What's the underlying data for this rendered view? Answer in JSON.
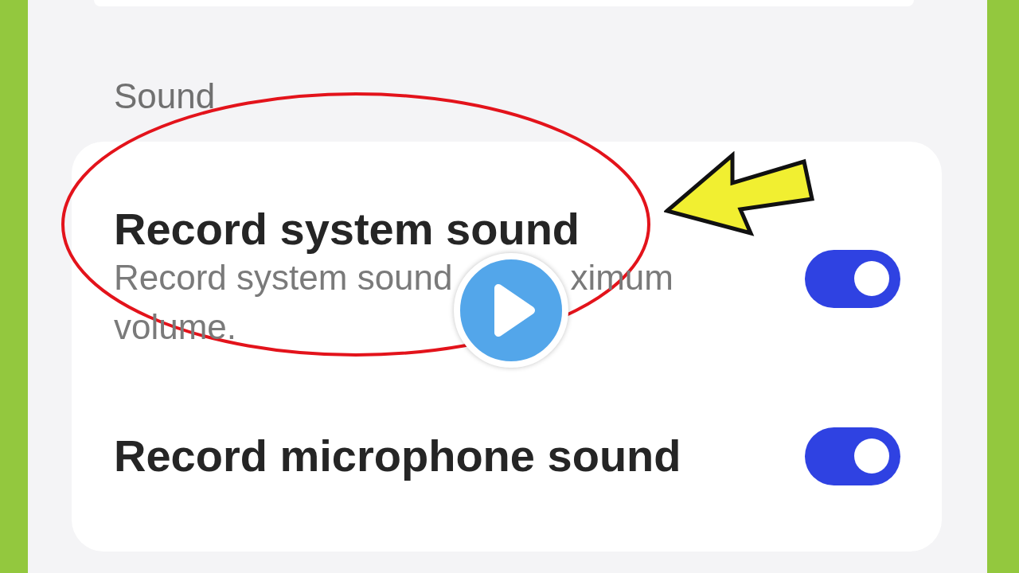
{
  "section_header": "Sound",
  "settings": [
    {
      "title": "Record system sound",
      "description_lines": [
        [
          "Record system sound",
          "ximum"
        ],
        [
          "volume."
        ]
      ],
      "on": true
    },
    {
      "title": "Record microphone sound",
      "on": true
    }
  ]
}
